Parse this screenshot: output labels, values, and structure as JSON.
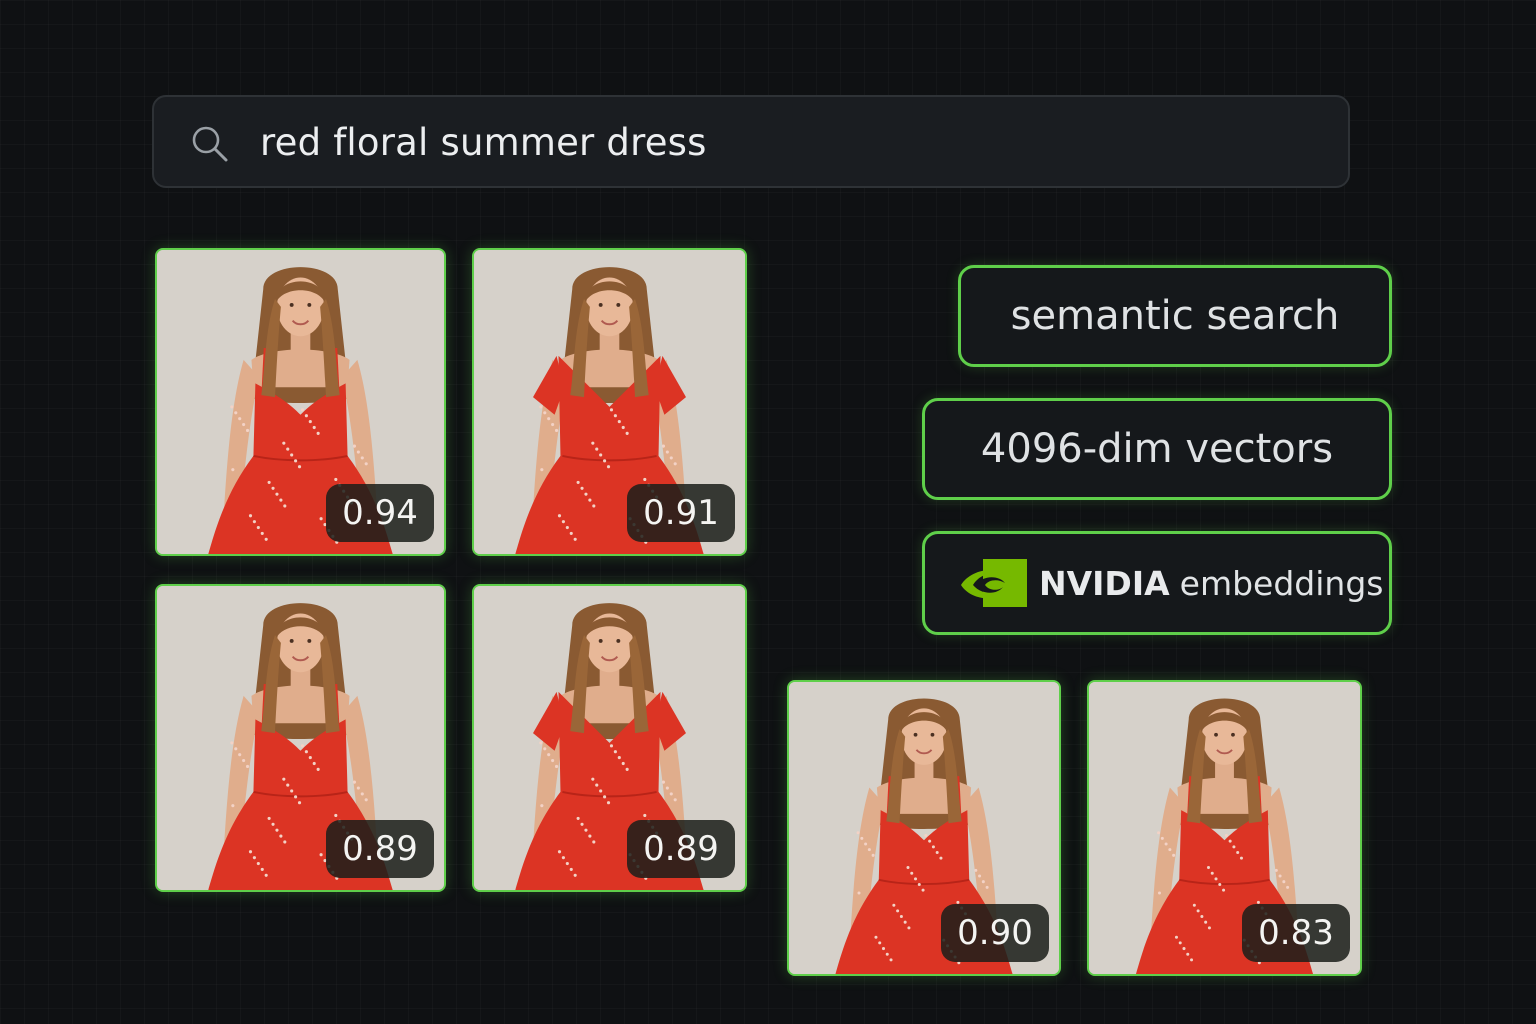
{
  "search": {
    "query": "red floral summer dress",
    "icon": "search-icon"
  },
  "results": [
    {
      "score": "0.94",
      "sleeve": "strap"
    },
    {
      "score": "0.91",
      "sleeve": "short"
    },
    {
      "score": "0.89",
      "sleeve": "strap"
    },
    {
      "score": "0.89",
      "sleeve": "short"
    },
    {
      "score": "0.90",
      "sleeve": "strap"
    },
    {
      "score": "0.83",
      "sleeve": "strap"
    }
  ],
  "features": {
    "semantic": "semantic search",
    "vectors": "4096-dim vectors",
    "nvidia_brand": "NVIDIA",
    "nvidia_text": "embeddings"
  },
  "colors": {
    "accent": "#5fcf4a",
    "background": "#0f1113",
    "dress": "#dc3424",
    "photo_bg": "#d6d1ca"
  }
}
